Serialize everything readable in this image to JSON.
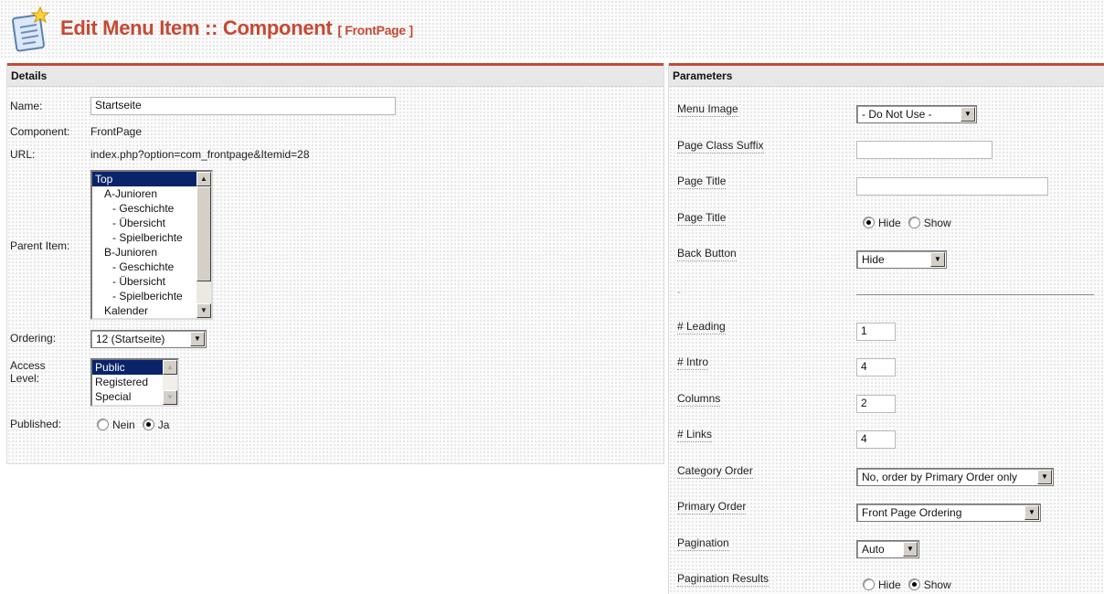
{
  "header": {
    "icon": "edit-document-icon",
    "title": "Edit Menu Item :: Component",
    "subtitle": "[ FrontPage ]"
  },
  "details": {
    "heading": "Details",
    "name_label": "Name:",
    "name_value": "Startseite",
    "component_label": "Component:",
    "component_value": "FrontPage",
    "url_label": "URL:",
    "url_value": "index.php?option=com_frontpage&Itemid=28",
    "parent_label": "Parent Item:",
    "parent_items": [
      "Top",
      "A-Junioren",
      "- Geschichte",
      "- Übersicht",
      "- Spielberichte",
      "B-Junioren",
      "- Geschichte",
      "- Übersicht",
      "- Spielberichte",
      "Kalender"
    ],
    "parent_selected": "Top",
    "ordering_label": "Ordering:",
    "ordering_value": "12 (Startseite)",
    "access_label": "Access Level:",
    "access_items": [
      "Public",
      "Registered",
      "Special"
    ],
    "access_selected": "Public",
    "published_label": "Published:",
    "published_options": [
      "Nein",
      "Ja"
    ],
    "published_value": "Ja"
  },
  "params": {
    "heading": "Parameters",
    "menu_image_label": "Menu Image",
    "menu_image_value": "- Do Not Use -",
    "page_class_label": "Page Class Suffix",
    "page_class_value": "",
    "page_title_label": "Page Title",
    "page_title_value": "",
    "page_title_show_label": "Page Title",
    "page_title_show_options": [
      "Hide",
      "Show"
    ],
    "page_title_show_value": "Hide",
    "back_button_label": "Back Button",
    "back_button_value": "Hide",
    "separator_label": "-",
    "leading_label": "# Leading",
    "leading_value": "1",
    "intro_label": "# Intro",
    "intro_value": "4",
    "columns_label": "Columns",
    "columns_value": "2",
    "links_label": "# Links",
    "links_value": "4",
    "category_order_label": "Category Order",
    "category_order_value": "No, order by Primary Order only",
    "primary_order_label": "Primary Order",
    "primary_order_value": "Front Page Ordering",
    "pagination_label": "Pagination",
    "pagination_value": "Auto",
    "pagination_results_label": "Pagination Results",
    "pagination_results_options": [
      "Hide",
      "Show"
    ],
    "pagination_results_value": "Show"
  },
  "colors": {
    "accent": "#c64934",
    "selection": "#0a246a"
  }
}
